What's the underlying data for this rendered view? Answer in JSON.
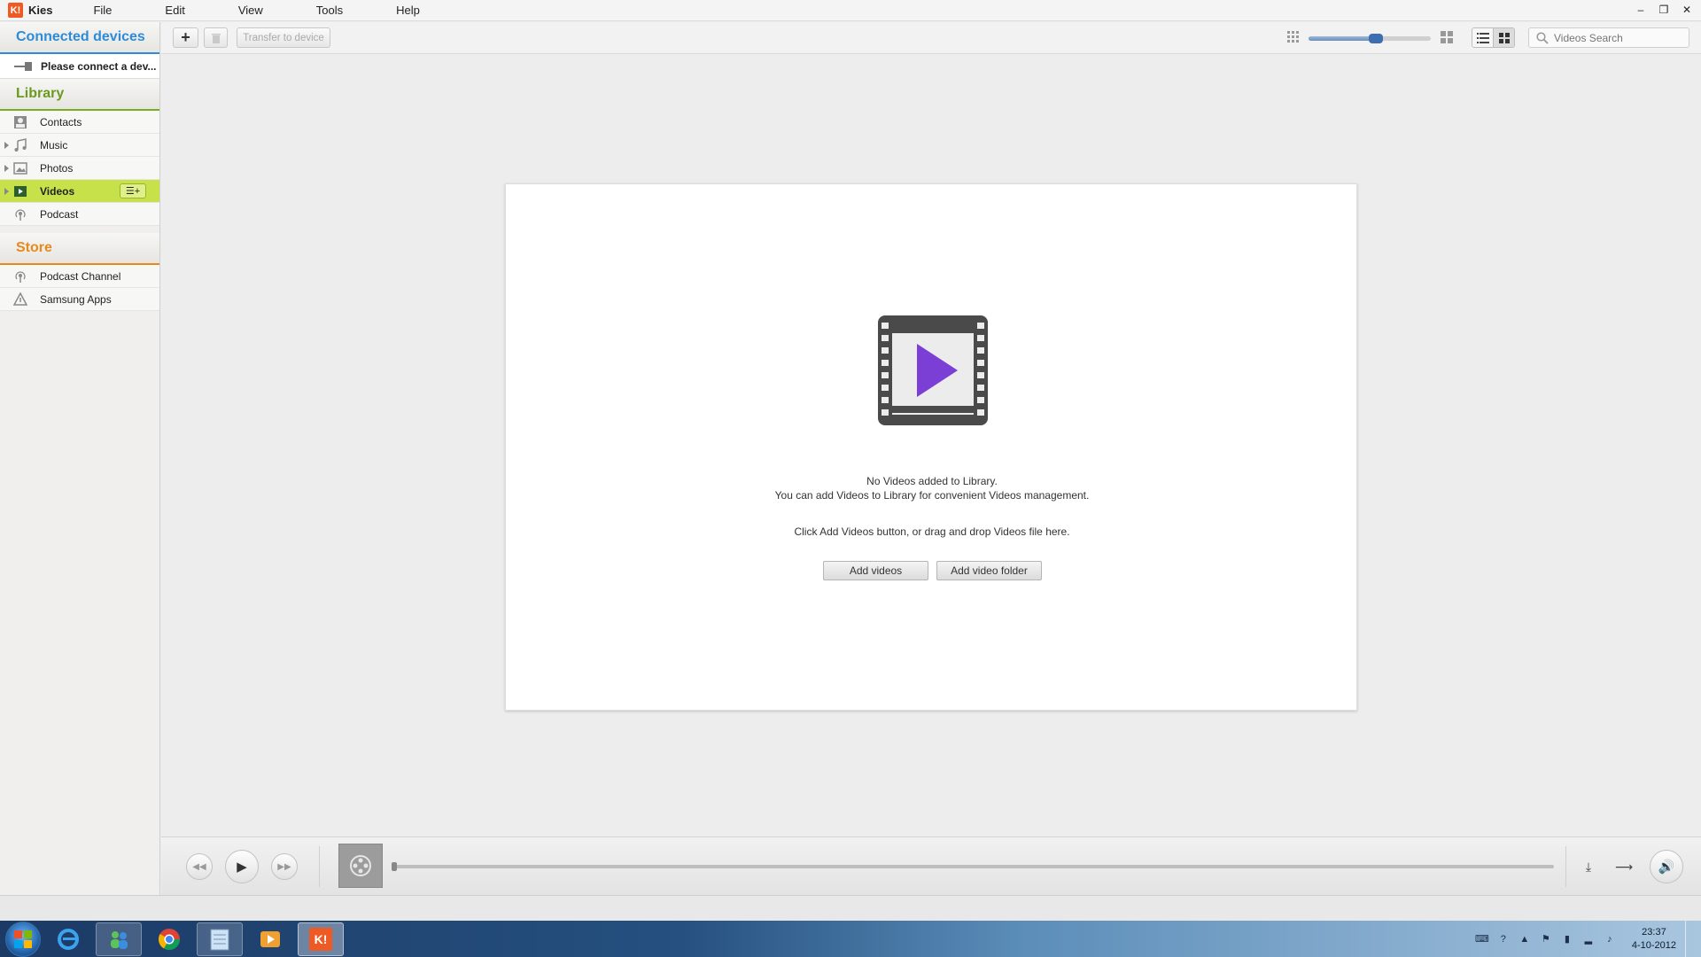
{
  "app": {
    "name": "Kies",
    "logo_text": "K!"
  },
  "menu": [
    "File",
    "Edit",
    "View",
    "Tools",
    "Help"
  ],
  "window_controls": {
    "minimize": "–",
    "restore": "❐",
    "close": "✕"
  },
  "sidebar": {
    "connected_header": "Connected devices",
    "device_status": "Please connect a dev...",
    "library_header": "Library",
    "library_items": [
      {
        "label": "Contacts",
        "icon": "contacts-icon"
      },
      {
        "label": "Music",
        "icon": "music-icon"
      },
      {
        "label": "Photos",
        "icon": "photos-icon"
      },
      {
        "label": "Videos",
        "icon": "videos-icon",
        "active": true
      },
      {
        "label": "Podcast",
        "icon": "podcast-icon"
      }
    ],
    "store_header": "Store",
    "store_items": [
      {
        "label": "Podcast Channel",
        "icon": "podcast-channel-icon"
      },
      {
        "label": "Samsung Apps",
        "icon": "samsung-apps-icon"
      }
    ]
  },
  "toolbar": {
    "add_label": "+",
    "transfer_label": "Transfer to device",
    "search_placeholder": "Videos Search",
    "zoom_level": 0.55
  },
  "empty_state": {
    "line1": "No Videos added to Library.",
    "line2": "You can add Videos to Library for convenient Videos management.",
    "hint": "Click Add Videos button, or drag and drop Videos file here.",
    "add_videos_label": "Add videos",
    "add_folder_label": "Add video folder"
  },
  "player": {
    "progress": 0
  },
  "taskbar": {
    "apps": [
      "internet-explorer-icon",
      "windows-live-messenger-icon",
      "chrome-icon",
      "notepad-icon",
      "media-player-icon",
      "kies-icon"
    ],
    "time": "23:37",
    "date": "4-10-2012"
  },
  "colors": {
    "connected_accent": "#2e8bd6",
    "library_accent": "#7aae21",
    "store_accent": "#e68a1c",
    "active_item": "#c6e14a",
    "play_purple": "#7b3fd6"
  }
}
